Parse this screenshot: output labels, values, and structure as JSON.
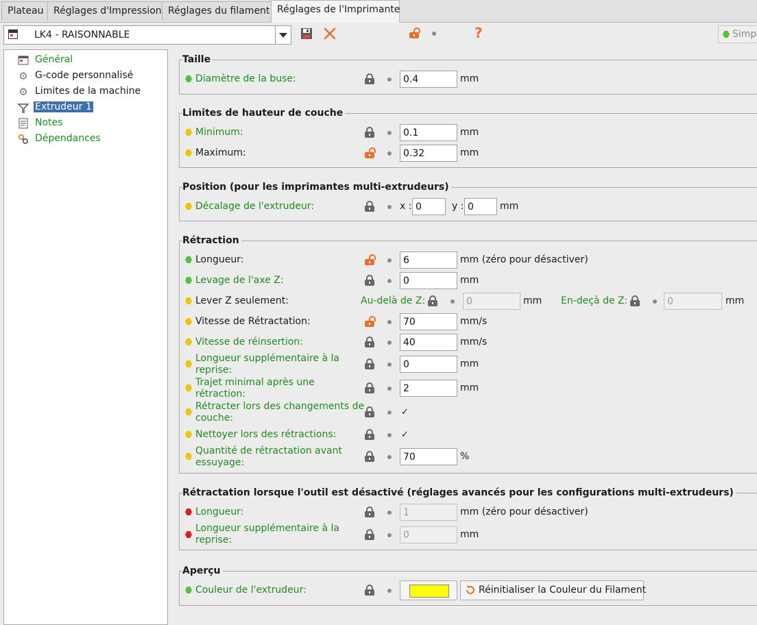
{
  "tabs": [
    {
      "label": "Plateau",
      "active": false
    },
    {
      "label": "Réglages d'Impression",
      "active": false
    },
    {
      "label": "Réglages du filament",
      "active": false
    },
    {
      "label": "Réglages de l'Imprimante",
      "active": true
    }
  ],
  "toolbar": {
    "preset_name": "LK4 - RAISONNABLE",
    "icons": [
      "window-icon",
      "save-icon",
      "delete-icon",
      "unlock-icon",
      "dot-icon",
      "question-icon"
    ],
    "mode_label": "Simpl"
  },
  "tree": [
    {
      "label": "Général",
      "icon": "printer-icon",
      "style": "green"
    },
    {
      "label": "G-code personnalisé",
      "icon": "gear-icon",
      "style": "dark"
    },
    {
      "label": "Limites de la machine",
      "icon": "gear-icon",
      "style": "dark"
    },
    {
      "label": "Extrudeur 1",
      "icon": "funnel-icon",
      "style": "selected"
    },
    {
      "label": "Notes",
      "icon": "notes-icon",
      "style": "green"
    },
    {
      "label": "Dépendances",
      "icon": "dependencies-icon",
      "style": "green"
    }
  ],
  "colors": {
    "simple": "#54c23d",
    "advanced": "#f0c400",
    "expert": "#d92020",
    "label_green": "#1f8a1f",
    "unlocked": "#e8702a",
    "extruder_color": "#ffff00"
  },
  "groups": {
    "taille": {
      "title": "Taille",
      "nozzle": {
        "label": "Diamètre de la buse:",
        "value": "0.4",
        "unit": "mm"
      }
    },
    "layer_limits": {
      "title": "Limites de hauteur de couche",
      "min": {
        "label": "Minimum:",
        "value": "0.1",
        "unit": "mm"
      },
      "max": {
        "label": "Maximum:",
        "value": "0.32",
        "unit": "mm"
      }
    },
    "position": {
      "title": "Position (pour les imprimantes multi-extrudeurs)",
      "offset": {
        "label": "Décalage de l'extrudeur:",
        "x_label": "x :",
        "x": "0",
        "y_label": "y :",
        "y": "0",
        "unit": "mm"
      }
    },
    "retraction": {
      "title": "Rétraction",
      "length": {
        "label": "Longueur:",
        "value": "6",
        "unit": "mm (zéro pour désactiver)"
      },
      "lift_z": {
        "label": "Levage de l'axe Z:",
        "value": "0",
        "unit": "mm"
      },
      "only_lift_z": {
        "label": "Lever Z seulement:",
        "above_label": "Au-delà de Z:",
        "above": "0",
        "below_label": "En-deçà de Z:",
        "below": "0",
        "unit": "mm"
      },
      "speed": {
        "label": "Vitesse de Rétractation:",
        "value": "70",
        "unit": "mm/s"
      },
      "deretract": {
        "label": "Vitesse de réinsertion:",
        "value": "40",
        "unit": "mm/s"
      },
      "restart_extra": {
        "label_line1": "Longueur supplémentaire à la",
        "label_line2": "reprise:",
        "value": "0",
        "unit": "mm"
      },
      "min_travel": {
        "label_line1": "Trajet minimal après une",
        "label_line2": "rétraction:",
        "value": "2",
        "unit": "mm"
      },
      "layer_change": {
        "label_line1": "Rétracter lors des changements de",
        "label_line2": "couche:",
        "checked": "✓"
      },
      "wipe": {
        "label": "Nettoyer lors des rétractions:",
        "checked": "✓"
      },
      "before_wipe": {
        "label_line1": "Quantité de rétractation avant",
        "label_line2": "essuyage:",
        "value": "70",
        "unit": "%"
      }
    },
    "toolchange": {
      "title": "Rétractation lorsque l'outil est désactivé (réglages avancés pour les configurations multi-extrudeurs)",
      "length": {
        "label": "Longueur:",
        "value": "1",
        "unit": "mm (zéro pour désactiver)"
      },
      "restart_extra": {
        "label_line1": "Longueur supplémentaire à la",
        "label_line2": "reprise:",
        "value": "0",
        "unit": "mm"
      }
    },
    "preview": {
      "title": "Aperçu",
      "color": {
        "label": "Couleur de l'extrudeur:",
        "reset_label": "Réinitialiser la Couleur du Filament"
      }
    }
  }
}
